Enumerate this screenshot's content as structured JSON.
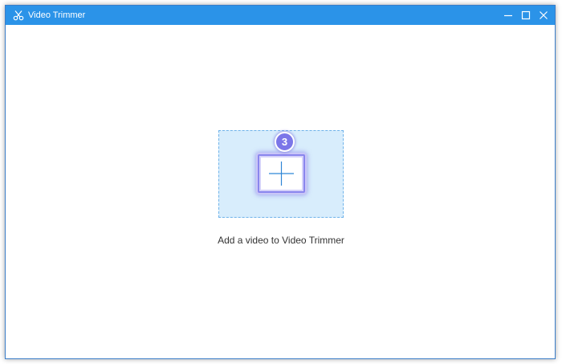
{
  "window": {
    "title": "Video Trimmer",
    "icon": "scissors-icon"
  },
  "controls": {
    "minimize": "minimize-icon",
    "maximize": "maximize-icon",
    "close": "close-icon"
  },
  "dropzone": {
    "icon": "plus-icon",
    "step_badge": "3",
    "hint": "Add a video to Video Trimmer"
  },
  "colors": {
    "titlebar": "#2b93e8",
    "dropzone_fill": "#d8edfc",
    "dropzone_border": "#6fb3ea",
    "badge": "#7b76e8",
    "highlight": "#8a86ee"
  }
}
